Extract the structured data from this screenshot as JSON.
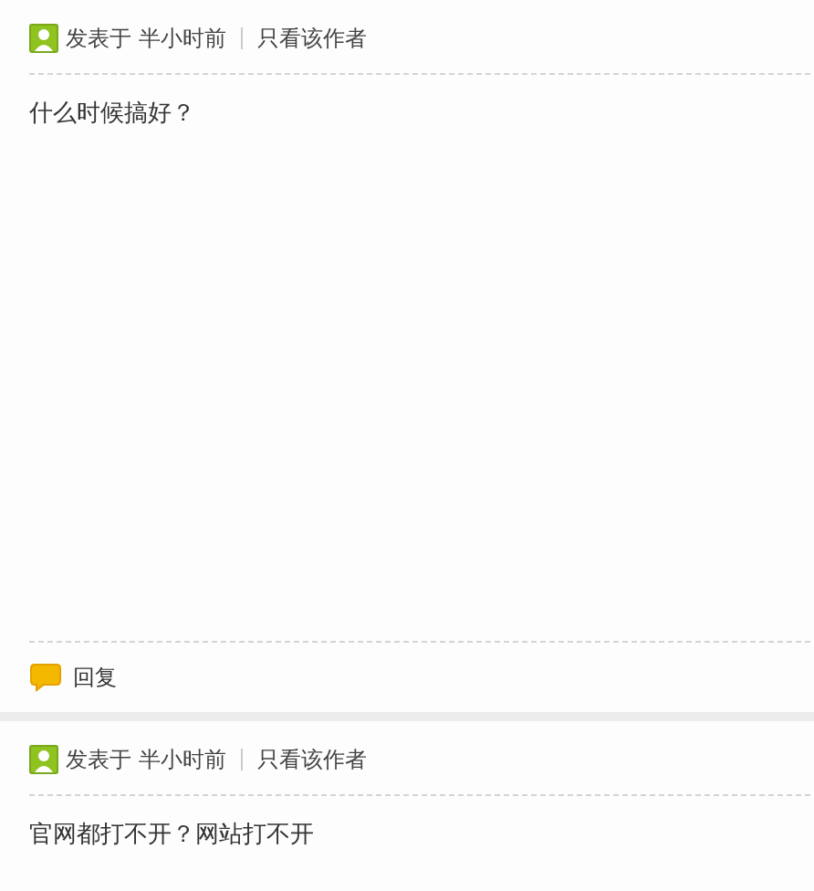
{
  "posts": [
    {
      "posted": "发表于 半小时前",
      "author_only": "只看该作者",
      "body": "什么时候搞好？",
      "reply": "回复"
    },
    {
      "posted": "发表于 半小时前",
      "author_only": "只看该作者",
      "body": "官网都打不开？网站打不开"
    }
  ]
}
